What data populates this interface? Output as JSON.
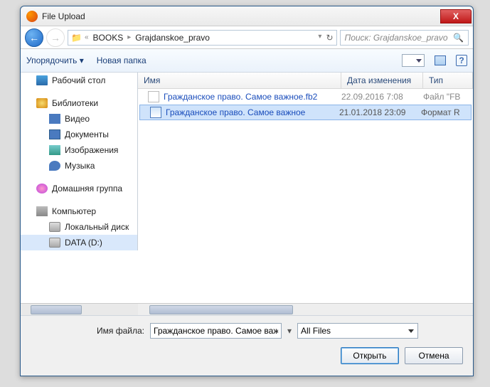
{
  "window": {
    "title": "File Upload",
    "close": "X"
  },
  "nav": {
    "crumb_sep": "«",
    "crumb1": "BOOKS",
    "crumb2": "Grajdanskoe_pravo",
    "search_placeholder": "Поиск: Grajdanskoe_pravo"
  },
  "toolbar": {
    "organize": "Упорядочить ▾",
    "newfolder": "Новая папка",
    "help": "?"
  },
  "tree": {
    "desktop": "Рабочий стол",
    "libraries": "Библиотеки",
    "video": "Видео",
    "documents": "Документы",
    "images": "Изображения",
    "music": "Музыка",
    "homegroup": "Домашняя группа",
    "computer": "Компьютер",
    "localdisk": "Локальный диск",
    "datad": "DATA (D:)"
  },
  "columns": {
    "name": "Имя",
    "date": "Дата изменения",
    "type": "Тип"
  },
  "files": [
    {
      "name": "Гражданское право. Самое важное.fb2",
      "date": "22.09.2016 7:08",
      "type": "Файл \"FB"
    },
    {
      "name": "Гражданское право. Самое важное",
      "date": "21.01.2018 23:09",
      "type": "Формат R"
    }
  ],
  "footer": {
    "filename_label": "Имя файла:",
    "filename_value": "Гражданское право. Самое важное",
    "filter": "All Files",
    "open": "Открыть",
    "cancel": "Отмена"
  }
}
